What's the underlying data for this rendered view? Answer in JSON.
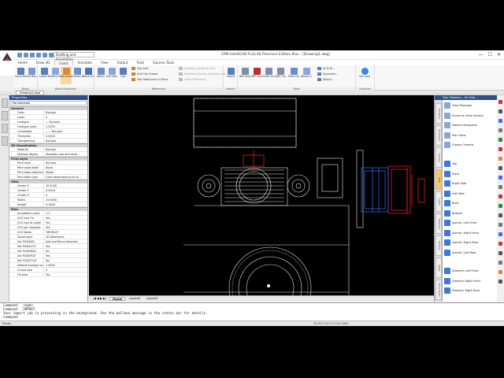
{
  "window": {
    "title": "CMS IntelliCAD 9.2a 64 Premium Edition Plus - [Drawing1.dwg]",
    "workspace": "Drafting and Annotation",
    "controls": [
      "—",
      "☐",
      "✕"
    ]
  },
  "ribbon": {
    "tabs": [
      "Home",
      "Draw 3D",
      "Insert",
      "Annotate",
      "View",
      "Output",
      "Tools",
      "Express Tools"
    ],
    "active_tab": "Insert",
    "groups": [
      {
        "label": "Block",
        "buttons": [
          "Insert Block",
          "Edit Block Attributes"
        ]
      },
      {
        "label": "Block Definition",
        "buttons": [
          "Create Block",
          "Define Attributes",
          "Attribute Display",
          "Extract Attributes",
          "Block Editor"
        ]
      },
      {
        "label": "Reference",
        "buttons": [
          "Attach",
          "Xref Manager",
          "Clip"
        ],
        "small": [
          "Clip Xref",
          "Xref Clip Frame",
          "Edit Reference In-Place",
          "Underlay Underlay Grd",
          "Reference Action Underlay Grd",
          "Close Reference"
        ]
      },
      {
        "label": "Import",
        "buttons": [
          "Import"
        ]
      },
      {
        "label": "Data",
        "buttons": [
          "BIM Underlay",
          "PDF Underlay",
          "DGN Underlay",
          "DWF Underlay",
          "Point Cloud Underlay",
          "Attach Underlay"
        ],
        "small": [
          "ACIS fil...",
          "Hyperlink...",
          "Attach..."
        ]
      },
      {
        "label": "Location",
        "buttons": [
          "Set Location"
        ]
      }
    ]
  },
  "layout_tab": "Drawing1.dwg",
  "properties": {
    "header": "Properties",
    "selection": "No selection",
    "sections": [
      {
        "title": "General",
        "rows": [
          [
            "Color",
            "ByLayer"
          ],
          [
            "Layer",
            "0"
          ],
          [
            "Linetype",
            "— ByLayer"
          ],
          [
            "Linetype scale",
            "1.0000"
          ],
          [
            "Lineweight",
            "—— ByLayer"
          ],
          [
            "Thickness",
            "0.0000"
          ],
          [
            "Transparency",
            "ByLayer"
          ]
        ]
      },
      {
        "title": "3D Visualization",
        "rows": [
          [
            "Material",
            "ByLayer"
          ],
          [
            "Shadow display",
            "Shadows cast and recei..."
          ]
        ]
      },
      {
        "title": "Print style",
        "rows": [
          [
            "Print style",
            "ByColor"
          ],
          [
            "Print style table",
            "None"
          ],
          [
            "Print table attached to",
            "Model"
          ],
          [
            "Print table type",
            "Color-dependent print st..."
          ]
        ]
      },
      {
        "title": "View",
        "rows": [
          [
            "Center X",
            "10.4030"
          ],
          [
            "Center Y",
            "0.9000"
          ],
          [
            "Center Z",
            "0"
          ],
          [
            "Width",
            "15.6040"
          ],
          [
            "Height",
            "9.1600"
          ]
        ]
      },
      {
        "title": "Misc",
        "rows": [
          [
            "Annotation scale",
            "1:1"
          ],
          [
            "UCS icon On",
            "Yes"
          ],
          [
            "UCS icon at origin",
            "Yes"
          ],
          [
            "UCS per viewport",
            "Yes"
          ],
          [
            "UCS Name",
            "*WORLD*"
          ],
          [
            "Visual style",
            "2D Wireframe"
          ],
          [
            "Set PICKADD",
            "Add and Remo Selected"
          ],
          [
            "Set PICKAUTO",
            "Yes"
          ],
          [
            "Set PICKDRAG",
            "No"
          ],
          [
            "Set PICKFIRST",
            "Yes"
          ],
          [
            "Set PICKSTYLE",
            "No"
          ],
          [
            "Default linetype scale",
            "1.0000"
          ],
          [
            "Cursor size",
            "5"
          ],
          [
            "Fill area",
            "Yes"
          ]
        ]
      }
    ]
  },
  "layouts": [
    "Model",
    "Layout1",
    "Layout2"
  ],
  "tool_palette": {
    "header": "Tool Palettes - All Pale...",
    "side_tabs": [
      "Modeling",
      "Annotation",
      "Camera",
      "View",
      "Lights",
      "Materials",
      "Hatches",
      "Tables",
      "Visual Styles"
    ],
    "group1": [
      "View Manager",
      "Dynamic View Control",
      "Named Viewports",
      "Plan View",
      "Create Camera"
    ],
    "group2": [
      "Top",
      "Front",
      "Right Side",
      "Left Side",
      "Back",
      "Bottom",
      "Isomet. Left Front",
      "Isomet. Right Front",
      "Isomet. Right Rear",
      "Isomet. Left Rear"
    ],
    "group3": [
      "Dimetric Left Front",
      "Dimetric Right Front",
      "Dimetric Right Rear"
    ]
  },
  "command_lines": [
    "Command: _regen",
    "Command: _IMPORT",
    "Your import job is processing in the background. See the balloon message in the status bar for details.",
    "Command:"
  ],
  "status": {
    "left": "Ready",
    "coords": "16.9273,20.2713,0.0000"
  },
  "colors": {
    "accent": "#2c4f88",
    "drawing_line": "#e6e6e6",
    "highlight_red": "#ff2020",
    "highlight_blue": "#3a6cff"
  }
}
